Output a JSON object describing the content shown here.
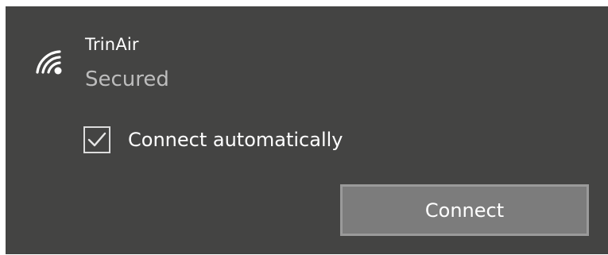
{
  "network": {
    "name": "TrinAir",
    "status": "Secured",
    "icon": "wifi-secured-icon"
  },
  "connect_automatically": {
    "label": "Connect automatically",
    "checked": true
  },
  "actions": {
    "connect_label": "Connect"
  },
  "colors": {
    "panel_background": "#444443",
    "text_primary": "#ffffff",
    "text_secondary": "#bdbdbd",
    "button_background": "#7c7c7c",
    "button_border": "#9a9a9a"
  }
}
